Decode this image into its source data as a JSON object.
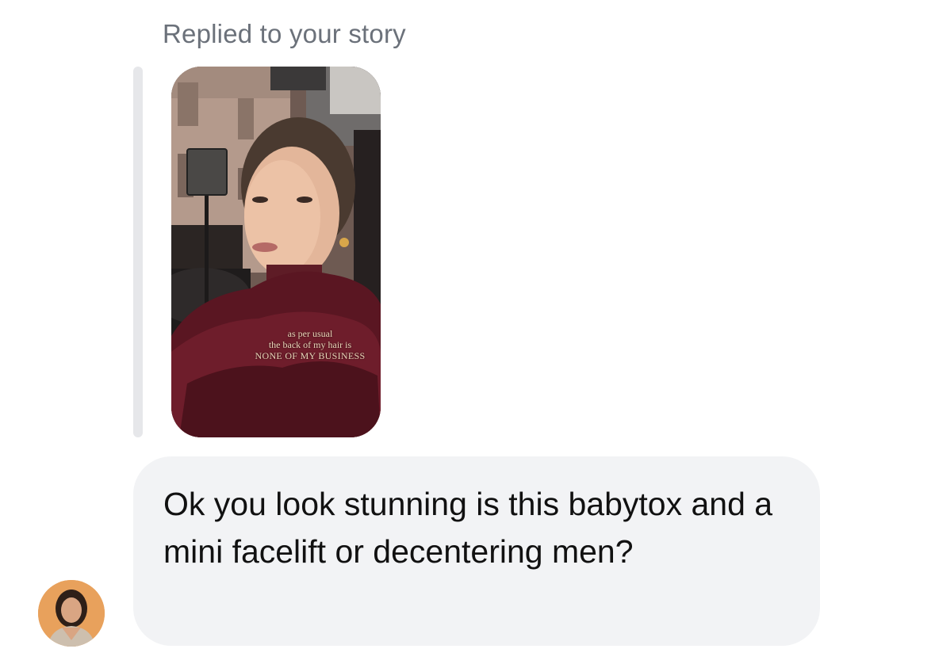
{
  "thread": {
    "reply_label": "Replied to your story",
    "story": {
      "caption_line_1": "as per usual",
      "caption_line_2": "the back of my hair is",
      "caption_line_3": "NONE OF MY BUSINESS"
    },
    "message": {
      "text": "Ok you look stunning is this babytox and a mini facelift or decentering men?"
    },
    "sender": {
      "avatar_icon": "profile-photo"
    }
  },
  "colors": {
    "label_gray": "#6b717a",
    "bubble_bg": "#f2f3f5",
    "quote_bar": "#e6e7ea",
    "avatar_bg": "#e8a15c"
  }
}
